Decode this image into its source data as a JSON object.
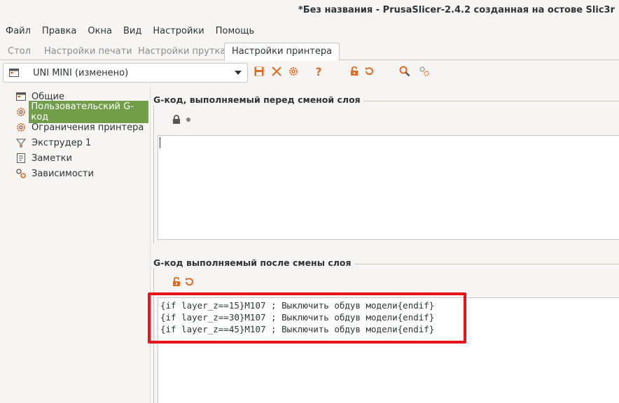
{
  "window": {
    "title": "*Без названия - PrusaSlicer-2.4.2 созданная на остове Slic3r"
  },
  "menu": [
    "Файл",
    "Правка",
    "Окна",
    "Вид",
    "Настройки",
    "Помощь"
  ],
  "tabs": [
    "Стол",
    "Настройки печати",
    "Настройки прутка",
    "Настройки принтера"
  ],
  "active_tab": "Настройки принтера",
  "preset": {
    "value": "UNI MINI (изменено)"
  },
  "toolbar": {
    "icons": [
      "save-icon",
      "delete-icon",
      "compare-icon",
      "help-icon",
      "lock-icon",
      "undo-icon",
      "search-icon",
      "settings-icon"
    ],
    "help_glyph": "?"
  },
  "sidebar": {
    "items": [
      {
        "label": "Общие",
        "icon": "general-icon"
      },
      {
        "label": "Пользовательский G-код",
        "icon": "gcode-icon",
        "selected": true
      },
      {
        "label": "Ограничения принтера",
        "icon": "limits-icon"
      },
      {
        "label": "Экструдер 1",
        "icon": "extruder-icon"
      },
      {
        "label": "Заметки",
        "icon": "notes-icon"
      },
      {
        "label": "Зависимости",
        "icon": "dependencies-icon"
      }
    ]
  },
  "before_layer_change": {
    "title": "G-код, выполняемый перед сменой слоя",
    "code": "",
    "status_icons": [
      "lock-icon",
      "dot-icon"
    ]
  },
  "after_layer_change": {
    "title": "G-код выполняемый после смены слоя",
    "code": "{if layer_z==15}M107 ; Выключить обдув модели{endif}\n{if layer_z==30}M107 ; Выключить обдув модели{endif}\n{if layer_z==45}M107 ; Выключить обдув модели{endif}",
    "status_icons": [
      "unlock-icon",
      "undo-icon"
    ]
  },
  "colors": {
    "accent_orange": "#e8681e",
    "selection_green": "#729e4a",
    "highlight_red": "#e8141a"
  }
}
